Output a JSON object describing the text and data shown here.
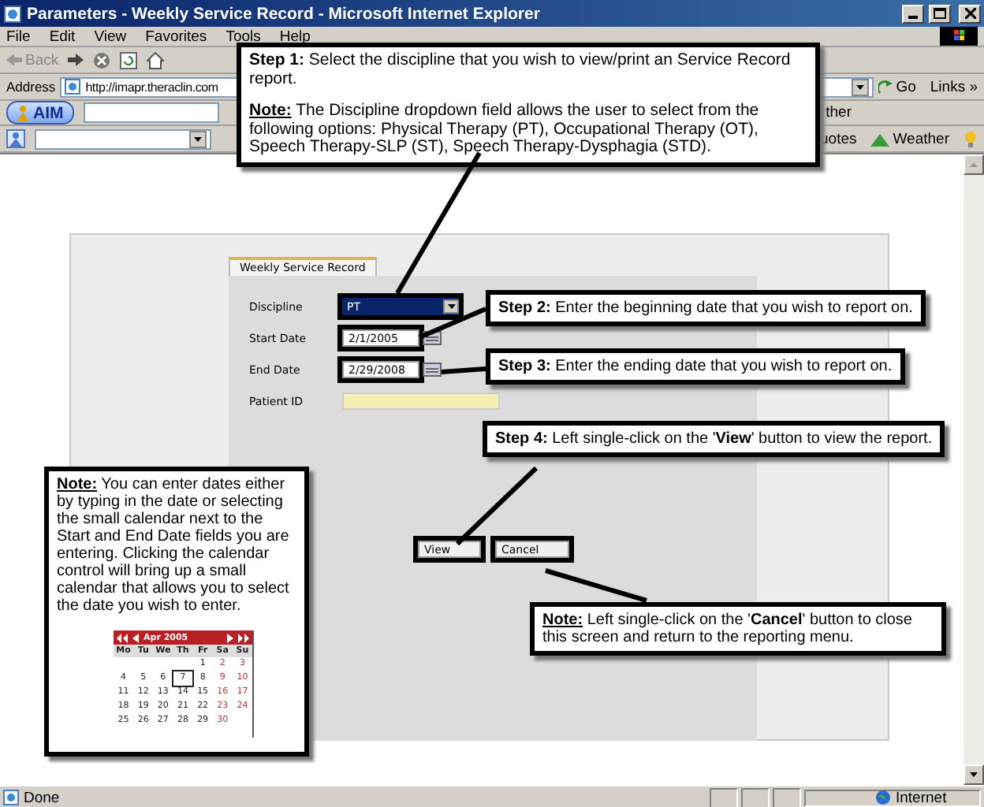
{
  "window": {
    "title": "Parameters - Weekly Service Record - Microsoft Internet Explorer"
  },
  "menu": [
    "File",
    "Edit",
    "View",
    "Favorites",
    "Tools",
    "Help"
  ],
  "toolbar": {
    "back": "Back"
  },
  "address_bar": {
    "label": "Address",
    "url": "http://imapr.theraclin.com",
    "go": "Go",
    "links": "Links »"
  },
  "aim_bar": {
    "button": "AIM",
    "partial_link": "ther"
  },
  "links_bar": {
    "items": [
      "uotes",
      "Weather"
    ]
  },
  "form": {
    "tab": "Weekly Service Record",
    "fields": [
      {
        "label": "Discipline",
        "kind": "select",
        "value": "PT"
      },
      {
        "label": "Start Date",
        "kind": "date",
        "value": "2/1/2005"
      },
      {
        "label": "End Date",
        "kind": "date",
        "value": "2/29/2008"
      },
      {
        "label": "Patient ID",
        "kind": "text"
      }
    ],
    "buttons": [
      "View",
      "Cancel"
    ]
  },
  "callouts": [
    {
      "paragraphs": [
        {
          "kind": "step",
          "text": "**Step 1:** Select the discipline that you wish to view/print an Service Record report."
        },
        {
          "kind": "note",
          "text": "**Note:** The Discipline dropdown field allows the user to select from the following options: Physical Therapy (PT), Occupational Therapy (OT), Speech Therapy-SLP (ST), Speech Therapy-Dysphagia (STD)."
        }
      ]
    },
    {
      "paragraphs": [
        {
          "kind": "step",
          "text": "**Step 2:** Enter the beginning date that you wish to report on."
        }
      ]
    },
    {
      "paragraphs": [
        {
          "kind": "step",
          "text": "**Step 3:** Enter the ending date that you wish to report on."
        }
      ]
    },
    {
      "paragraphs": [
        {
          "kind": "step",
          "text": "**Step 4:** Left single-click on the '**View**' button to view the report."
        }
      ]
    },
    {
      "paragraphs": [
        {
          "kind": "note",
          "text": "**Note:** You can enter dates either by typing in the date or selecting the small calendar next to the Start and End Date fields you are entering. Clicking the calendar control will bring up a small calendar that allows you to select the date you wish to enter."
        }
      ],
      "calendar": {
        "month": "Apr 2005",
        "weekdays": [
          "Mo",
          "Tu",
          "We",
          "Th",
          "Fr",
          "Sa",
          "Su"
        ],
        "weeks": [
          {
            "kind": "first",
            "days": [
              {
                "d": "1",
                "selected": false
              },
              {
                "d": "2",
                "selected": false
              },
              {
                "d": "3",
                "selected": false
              }
            ]
          },
          {
            "kind": "full",
            "days": [
              {
                "d": "4",
                "selected": false
              },
              {
                "d": "5",
                "selected": false
              },
              {
                "d": "6",
                "selected": false
              },
              {
                "d": "7",
                "selected": true
              },
              {
                "d": "8",
                "selected": false
              },
              {
                "d": "9",
                "selected": false
              },
              {
                "d": "10",
                "selected": false
              }
            ]
          },
          {
            "kind": "full",
            "days": [
              {
                "d": "11",
                "selected": false
              },
              {
                "d": "12",
                "selected": false
              },
              {
                "d": "13",
                "selected": false
              },
              {
                "d": "14",
                "selected": false
              },
              {
                "d": "15",
                "selected": false
              },
              {
                "d": "16",
                "selected": false
              },
              {
                "d": "17",
                "selected": false
              }
            ]
          },
          {
            "kind": "full",
            "days": [
              {
                "d": "18",
                "selected": false
              },
              {
                "d": "19",
                "selected": false
              },
              {
                "d": "20",
                "selected": false
              },
              {
                "d": "21",
                "selected": false
              },
              {
                "d": "22",
                "selected": false
              },
              {
                "d": "23",
                "selected": false
              },
              {
                "d": "24",
                "selected": false
              }
            ]
          },
          {
            "kind": "last",
            "days": [
              {
                "d": "25",
                "selected": false
              },
              {
                "d": "26",
                "selected": false
              },
              {
                "d": "27",
                "selected": false
              },
              {
                "d": "28",
                "selected": false
              },
              {
                "d": "29",
                "selected": false
              },
              {
                "d": "30",
                "selected": false
              }
            ]
          }
        ]
      }
    },
    {
      "paragraphs": [
        {
          "kind": "note",
          "text": "**Note:** Left single-click on the '**Cancel**' button to close this screen and return to the reporting menu."
        }
      ]
    }
  ],
  "status_bar": {
    "text": "Done",
    "zone": "Internet"
  }
}
